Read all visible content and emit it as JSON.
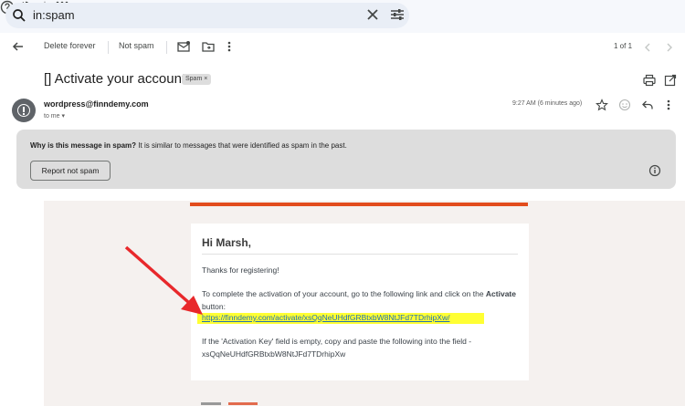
{
  "search": {
    "query": "in:spam"
  },
  "topbar": {
    "icons": [
      "search-icon",
      "clear-icon",
      "tune-icon",
      "help-icon",
      "settings-icon",
      "gemini-icon",
      "apps-icon"
    ]
  },
  "toolbar": {
    "delete_forever": "Delete forever",
    "not_spam": "Not spam",
    "page_range": "1 of 1"
  },
  "email": {
    "subject": "[] Activate your account",
    "label_chip": "Spam ×",
    "sender": "wordpress@finndemy.com",
    "to": "to me ▾",
    "time": "9:27 AM (6 minutes ago)"
  },
  "spam_banner": {
    "question": "Why is this message in spam?",
    "reason": " It is similar to messages that were identified as spam in the past.",
    "button": "Report not spam"
  },
  "body": {
    "greeting": "Hi Marsh,",
    "thanks": "Thanks for registering!",
    "instruction_pre": "To complete the activation of your account, go to the following link and click on the ",
    "instruction_bold": "Activate",
    "instruction_post": " button:",
    "link": "https://finndemy.com/activate/xsQqNeUHdfGRBtxbW8NtJFd7TDrhipXw/",
    "key_note": "If the 'Activation Key' field is empty, copy and paste the following into the field -",
    "key": "xsQqNeUHdfGRBtxbW8NtJFd7TDrhipXw"
  },
  "colors": {
    "accent_bar": "#e24c1c",
    "link_highlight": "#ffff33",
    "annotation_arrow": "#e8282b"
  }
}
